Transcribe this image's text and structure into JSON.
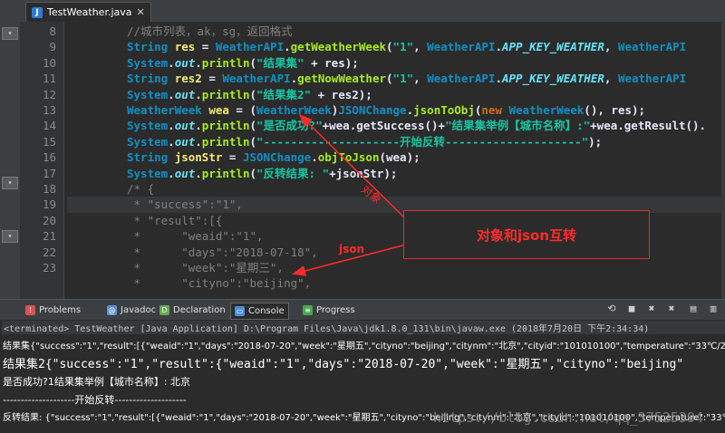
{
  "editor_tab": {
    "title": "TestWeather.java",
    "close": "✕",
    "file_badge": "J"
  },
  "left_gutter": {
    "buttons": [
      "▾",
      "▾",
      "▾"
    ]
  },
  "line_numbers": [
    "8",
    "9",
    "10",
    "11",
    "12",
    "13",
    "14",
    "15",
    "16",
    "17",
    "18",
    "19",
    "20",
    "21",
    "22",
    "23"
  ],
  "code_lines": [
    {
      "cls": "",
      "tokens": [
        {
          "c": "cm",
          "t": "//城市列表，ak，sg，返回格式"
        }
      ]
    },
    {
      "cls": "",
      "tokens": [
        {
          "c": "ty",
          "t": "String "
        },
        {
          "c": "vr",
          "t": "res"
        },
        {
          "c": "op",
          "t": " = "
        },
        {
          "c": "ty",
          "t": "WeatherAPI"
        },
        {
          "c": "op",
          "t": "."
        },
        {
          "c": "mt",
          "t": "getWeatherWeek"
        },
        {
          "c": "op",
          "t": "("
        },
        {
          "c": "st",
          "t": "\"1\""
        },
        {
          "c": "op",
          "t": ", "
        },
        {
          "c": "ty",
          "t": "WeatherAPI"
        },
        {
          "c": "op",
          "t": "."
        },
        {
          "c": "fi",
          "t": "APP_KEY_WEATHER"
        },
        {
          "c": "op",
          "t": ", "
        },
        {
          "c": "ty",
          "t": "WeatherAPI"
        }
      ]
    },
    {
      "cls": "",
      "tokens": [
        {
          "c": "ty",
          "t": "System"
        },
        {
          "c": "op",
          "t": "."
        },
        {
          "c": "fi",
          "t": "out"
        },
        {
          "c": "op",
          "t": "."
        },
        {
          "c": "mt",
          "t": "println"
        },
        {
          "c": "op",
          "t": "("
        },
        {
          "c": "st",
          "t": "\"结果集\""
        },
        {
          "c": "op",
          "t": " + res);"
        }
      ]
    },
    {
      "cls": "",
      "tokens": [
        {
          "c": "ty",
          "t": "String "
        },
        {
          "c": "vr",
          "t": "res2"
        },
        {
          "c": "op",
          "t": " = "
        },
        {
          "c": "ty",
          "t": "WeatherAPI"
        },
        {
          "c": "op",
          "t": "."
        },
        {
          "c": "mt",
          "t": "getNowWeather"
        },
        {
          "c": "op",
          "t": "("
        },
        {
          "c": "st",
          "t": "\"1\""
        },
        {
          "c": "op",
          "t": ", "
        },
        {
          "c": "ty",
          "t": "WeatherAPI"
        },
        {
          "c": "op",
          "t": "."
        },
        {
          "c": "fi",
          "t": "APP_KEY_WEATHER"
        },
        {
          "c": "op",
          "t": ", "
        },
        {
          "c": "ty",
          "t": "WeatherAPI"
        }
      ]
    },
    {
      "cls": "",
      "tokens": [
        {
          "c": "ty",
          "t": "System"
        },
        {
          "c": "op",
          "t": "."
        },
        {
          "c": "fi",
          "t": "out"
        },
        {
          "c": "op",
          "t": "."
        },
        {
          "c": "mt",
          "t": "println"
        },
        {
          "c": "op",
          "t": "("
        },
        {
          "c": "st",
          "t": "\"结果集2\""
        },
        {
          "c": "op",
          "t": " + res2);"
        }
      ]
    },
    {
      "cls": "",
      "tokens": [
        {
          "c": "ty",
          "t": "WeatherWeek "
        },
        {
          "c": "vr",
          "t": "wea"
        },
        {
          "c": "op",
          "t": " = ("
        },
        {
          "c": "ty",
          "t": "WeatherWeek"
        },
        {
          "c": "op",
          "t": ")"
        },
        {
          "c": "ty",
          "t": "JSONChange"
        },
        {
          "c": "op",
          "t": "."
        },
        {
          "c": "mt",
          "t": "jsonToObj"
        },
        {
          "c": "op",
          "t": "("
        },
        {
          "c": "kw",
          "t": "new "
        },
        {
          "c": "ty",
          "t": "WeatherWeek"
        },
        {
          "c": "op",
          "t": "(), res);"
        }
      ]
    },
    {
      "cls": "",
      "tokens": [
        {
          "c": "ty",
          "t": "System"
        },
        {
          "c": "op",
          "t": "."
        },
        {
          "c": "fi",
          "t": "out"
        },
        {
          "c": "op",
          "t": "."
        },
        {
          "c": "mt",
          "t": "println"
        },
        {
          "c": "op",
          "t": "("
        },
        {
          "c": "st",
          "t": "\"是否成功?\""
        },
        {
          "c": "op",
          "t": "+wea.getSuccess()+"
        },
        {
          "c": "st",
          "t": "\"结果集举例【城市名称】:\""
        },
        {
          "c": "op",
          "t": "+wea.getResult()."
        }
      ]
    },
    {
      "cls": "",
      "tokens": [
        {
          "c": "ty",
          "t": "System"
        },
        {
          "c": "op",
          "t": "."
        },
        {
          "c": "fi",
          "t": "out"
        },
        {
          "c": "op",
          "t": "."
        },
        {
          "c": "mt",
          "t": "println"
        },
        {
          "c": "op",
          "t": "("
        },
        {
          "c": "st",
          "t": "\"--------------------开始反转--------------------\""
        },
        {
          "c": "op",
          "t": ");"
        }
      ]
    },
    {
      "cls": "",
      "tokens": [
        {
          "c": "ty",
          "t": "String "
        },
        {
          "c": "vr",
          "t": "jsonStr"
        },
        {
          "c": "op",
          "t": " = "
        },
        {
          "c": "ty",
          "t": "JSONChange"
        },
        {
          "c": "op",
          "t": "."
        },
        {
          "c": "mt",
          "t": "objToJson"
        },
        {
          "c": "op",
          "t": "(wea);"
        }
      ]
    },
    {
      "cls": "",
      "tokens": [
        {
          "c": "ty",
          "t": "System"
        },
        {
          "c": "op",
          "t": "."
        },
        {
          "c": "fi",
          "t": "out"
        },
        {
          "c": "op",
          "t": "."
        },
        {
          "c": "mt",
          "t": "println"
        },
        {
          "c": "op",
          "t": "("
        },
        {
          "c": "st",
          "t": "\"反转结果: \""
        },
        {
          "c": "op",
          "t": "+jsonStr);"
        }
      ]
    },
    {
      "cls": "",
      "tokens": [
        {
          "c": "cm",
          "t": "/* {"
        }
      ]
    },
    {
      "cls": "hl",
      "tokens": [
        {
          "c": "cm",
          "t": " * \"success\":\"1\","
        }
      ]
    },
    {
      "cls": "",
      "tokens": [
        {
          "c": "cm",
          "t": " * \"result\":[{"
        }
      ]
    },
    {
      "cls": "",
      "tokens": [
        {
          "c": "cm",
          "t": " *      \"weaid\":\"1\","
        }
      ]
    },
    {
      "cls": "",
      "tokens": [
        {
          "c": "cm",
          "t": " *      \"days\":\"2018-07-18\","
        }
      ]
    },
    {
      "cls": "",
      "tokens": [
        {
          "c": "cm",
          "t": " *      \"week\":\"星期三\","
        }
      ]
    },
    {
      "cls": "",
      "tokens": [
        {
          "c": "cm",
          "t": " *      \"cityno\":\"beijing\","
        }
      ]
    }
  ],
  "annotations": {
    "box_label": "对象和json互转",
    "label_object": "对象",
    "label_json": "json"
  },
  "views": {
    "tabs": [
      {
        "label": "Problems",
        "icon": "problems-icon",
        "color": "#d9534f",
        "glyph": "!"
      },
      {
        "label": "Javadoc",
        "icon": "javadoc-icon",
        "color": "#5a8fd8",
        "glyph": "@"
      },
      {
        "label": "Declaration",
        "icon": "declaration-icon",
        "color": "#6aa84f",
        "glyph": "D"
      },
      {
        "label": "Console",
        "icon": "console-icon",
        "color": "#4a90d9",
        "glyph": "▭"
      },
      {
        "label": "Progress",
        "icon": "progress-icon",
        "color": "#4aa84f",
        "glyph": "≡"
      }
    ],
    "active": "Console"
  },
  "console": {
    "status": "<terminated> TestWeather [Java Application] D:\\Program Files\\Java\\jdk1.8.0_131\\bin\\javaw.exe (2018年7月20日 下午2:34:34)",
    "lines": [
      "结果集{\"success\":\"1\",\"result\":[{\"weaid\":\"1\",\"days\":\"2018-07-20\",\"week\":\"星期五\",\"cityno\":\"beijing\",\"citynm\":\"北京\",\"cityid\":\"101010100\",\"temperature\":\"33℃/27℃\"",
      "结果集2{\"success\":\"1\",\"result\":{\"weaid\":\"1\",\"days\":\"2018-07-20\",\"week\":\"星期五\",\"cityno\":\"beijing\"",
      "是否成功?1结果集举例【城市名称】: 北京",
      "--------------------开始反转--------------------",
      "反转结果: {\"success\":\"1\",\"result\":[{\"weaid\":\"1\",\"days\":\"2018-07-20\",\"week\":\"星期五\",\"cityno\":\"beijing\",\"citynm\":\"北京\",\"cityid\":\"101010100\",\"temperature\":\"33℃/2"
    ]
  },
  "watermark": "https://blog.csdn.net/qq_37525394",
  "colors": {
    "accent_red": "#ff2a2a",
    "editor_bg": "#2b2b2b"
  }
}
